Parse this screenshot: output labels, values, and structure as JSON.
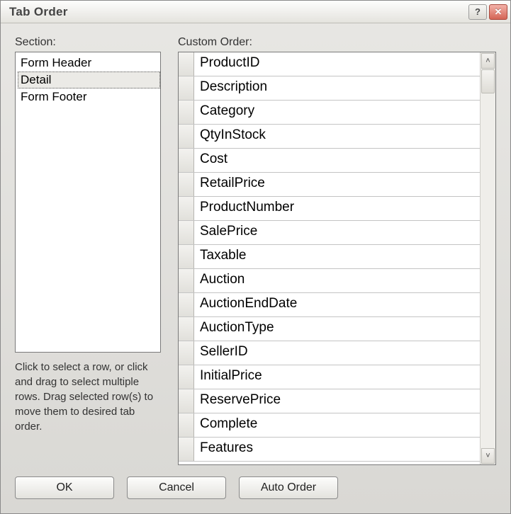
{
  "window": {
    "title": "Tab Order"
  },
  "section": {
    "label": "Section:",
    "items": [
      "Form Header",
      "Detail",
      "Form Footer"
    ],
    "selected_index": 1
  },
  "custom_order": {
    "label": "Custom Order:",
    "items": [
      "ProductID",
      "Description",
      "Category",
      "QtyInStock",
      "Cost",
      "RetailPrice",
      "ProductNumber",
      "SalePrice",
      "Taxable",
      "Auction",
      "AuctionEndDate",
      "AuctionType",
      "SellerID",
      "InitialPrice",
      "ReservePrice",
      "Complete",
      "Features"
    ]
  },
  "hint": "Click to select a row, or click and drag to select multiple rows.  Drag selected row(s) to move them to desired tab order.",
  "buttons": {
    "ok": "OK",
    "cancel": "Cancel",
    "auto_order": "Auto Order"
  }
}
